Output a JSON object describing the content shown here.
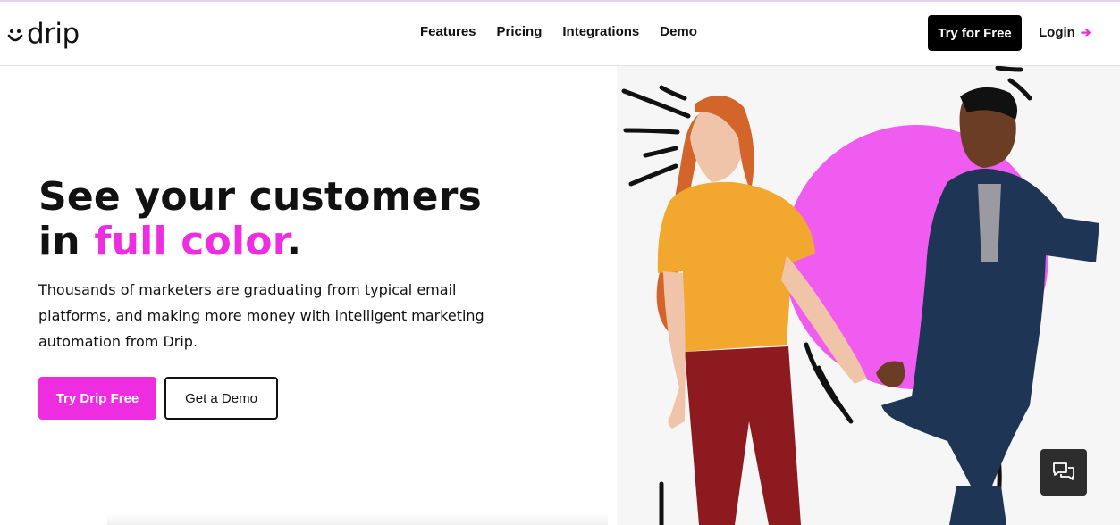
{
  "brand": {
    "name": "drip",
    "accent": "#ee2ce0",
    "dark": "#111111"
  },
  "nav": {
    "items": [
      {
        "label": "Features"
      },
      {
        "label": "Pricing"
      },
      {
        "label": "Integrations"
      },
      {
        "label": "Demo"
      }
    ],
    "cta_label": "Try for Free",
    "login_label": "Login",
    "login_icon": "arrow-right-icon"
  },
  "hero": {
    "headline_line1": "See your customers",
    "headline_line2_prefix": "in ",
    "headline_line2_accent": "full color",
    "headline_line2_suffix": ".",
    "subtext": "Thousands of marketers are graduating from typical email platforms, and making more money with intelligent marketing automation from Drip.",
    "primary_button": "Try Drip Free",
    "secondary_button": "Get a Demo"
  },
  "chat": {
    "icon": "chat-bubbles-icon"
  }
}
